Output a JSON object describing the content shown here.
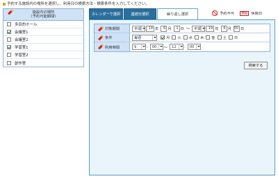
{
  "instruction": "予約する施設内の場所を選択し、利用日の検索方法・検索条件を入力してください。",
  "facility_panel": {
    "header_line1": "施設内の場所",
    "header_line2": "（予約可能期間）",
    "rows": [
      {
        "label": "多目的ホール",
        "checked": false
      },
      {
        "label": "会議室1",
        "checked": true
      },
      {
        "label": "会議室2",
        "checked": false
      },
      {
        "label": "学習室1",
        "checked": true
      },
      {
        "label": "学習室2",
        "checked": false
      },
      {
        "label": "創作室",
        "checked": false
      }
    ]
  },
  "tabs": [
    {
      "label": "カレンダーで選択",
      "active": false
    },
    {
      "label": "連続日選択",
      "active": false
    },
    {
      "label": "繰り返し選択",
      "active": true
    }
  ],
  "legend": {
    "unavailable_label": "予約不可",
    "closed_badge": "休館",
    "closed_label": "休館日"
  },
  "search_form": {
    "period": {
      "label": "対象期間",
      "from_era": "平成",
      "from_year": "19",
      "from_month": "6",
      "from_day": "1",
      "tilde": "～",
      "to_era": "平成",
      "to_year": "19",
      "to_month": "6",
      "to_day": "30",
      "unit_year": "年",
      "unit_month": "月",
      "unit_day": "日"
    },
    "condition": {
      "label": "条件",
      "repeat": "毎週",
      "days": [
        {
          "label": "月",
          "checked": true
        },
        {
          "label": "火",
          "checked": false
        },
        {
          "label": "水",
          "checked": false
        },
        {
          "label": "木",
          "checked": false
        },
        {
          "label": "金",
          "checked": false
        },
        {
          "label": "土",
          "checked": false
        },
        {
          "label": "日",
          "checked": false
        }
      ]
    },
    "time": {
      "label": "利用時間",
      "from_hour": "9",
      "from_min": "00",
      "tilde": "～",
      "to_hour": "12",
      "to_min": "00",
      "colon": ":"
    },
    "search_button": "検索する"
  }
}
